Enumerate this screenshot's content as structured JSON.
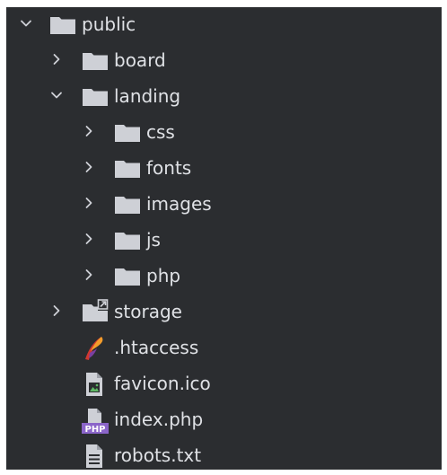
{
  "tree": {
    "root": {
      "label": "public",
      "icon": "folder-icon",
      "state": "expanded"
    },
    "items": [
      {
        "label": "board",
        "icon": "folder-icon",
        "state": "collapsed"
      },
      {
        "label": "landing",
        "icon": "folder-icon",
        "state": "expanded"
      },
      {
        "label": "css",
        "icon": "folder-icon",
        "state": "collapsed"
      },
      {
        "label": "fonts",
        "icon": "folder-icon",
        "state": "collapsed"
      },
      {
        "label": "images",
        "icon": "folder-icon",
        "state": "collapsed"
      },
      {
        "label": "js",
        "icon": "folder-icon",
        "state": "collapsed"
      },
      {
        "label": "php",
        "icon": "folder-icon",
        "state": "collapsed"
      },
      {
        "label": "storage",
        "icon": "symlink-folder-icon",
        "state": "collapsed"
      },
      {
        "label": ".htaccess",
        "icon": "apache-feather-icon"
      },
      {
        "label": "favicon.ico",
        "icon": "image-file-icon"
      },
      {
        "label": "index.php",
        "icon": "php-file-icon",
        "badge": "PHP"
      },
      {
        "label": "robots.txt",
        "icon": "text-file-icon"
      }
    ]
  },
  "colors": {
    "background": "#2b2d30",
    "text": "#dfe1e5",
    "icon": "#ced0d6",
    "php_badge": "#8b65c9",
    "feather_red": "#d1382f",
    "feather_orange": "#f39c2b",
    "feather_purple": "#7b3fa0"
  }
}
